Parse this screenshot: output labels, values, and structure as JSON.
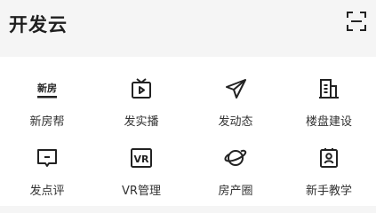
{
  "header": {
    "title": "开发云",
    "scan_icon": "scan-icon"
  },
  "grid": {
    "items": [
      {
        "label": "新房帮",
        "icon": "xinfang-badge-icon",
        "icon_text": "新房"
      },
      {
        "label": "发实播",
        "icon": "tv-play-icon"
      },
      {
        "label": "发动态",
        "icon": "paper-plane-icon"
      },
      {
        "label": "楼盘建设",
        "icon": "building-icon"
      },
      {
        "label": "发点评",
        "icon": "comment-box-icon"
      },
      {
        "label": "VR管理",
        "icon": "vr-badge-icon",
        "icon_text": "VR"
      },
      {
        "label": "房产圈",
        "icon": "planet-icon"
      },
      {
        "label": "新手教学",
        "icon": "person-card-icon"
      }
    ]
  },
  "colors": {
    "background": "#f5f5f5",
    "panel": "#ffffff",
    "icon_stroke": "#222222",
    "text": "#333333"
  }
}
